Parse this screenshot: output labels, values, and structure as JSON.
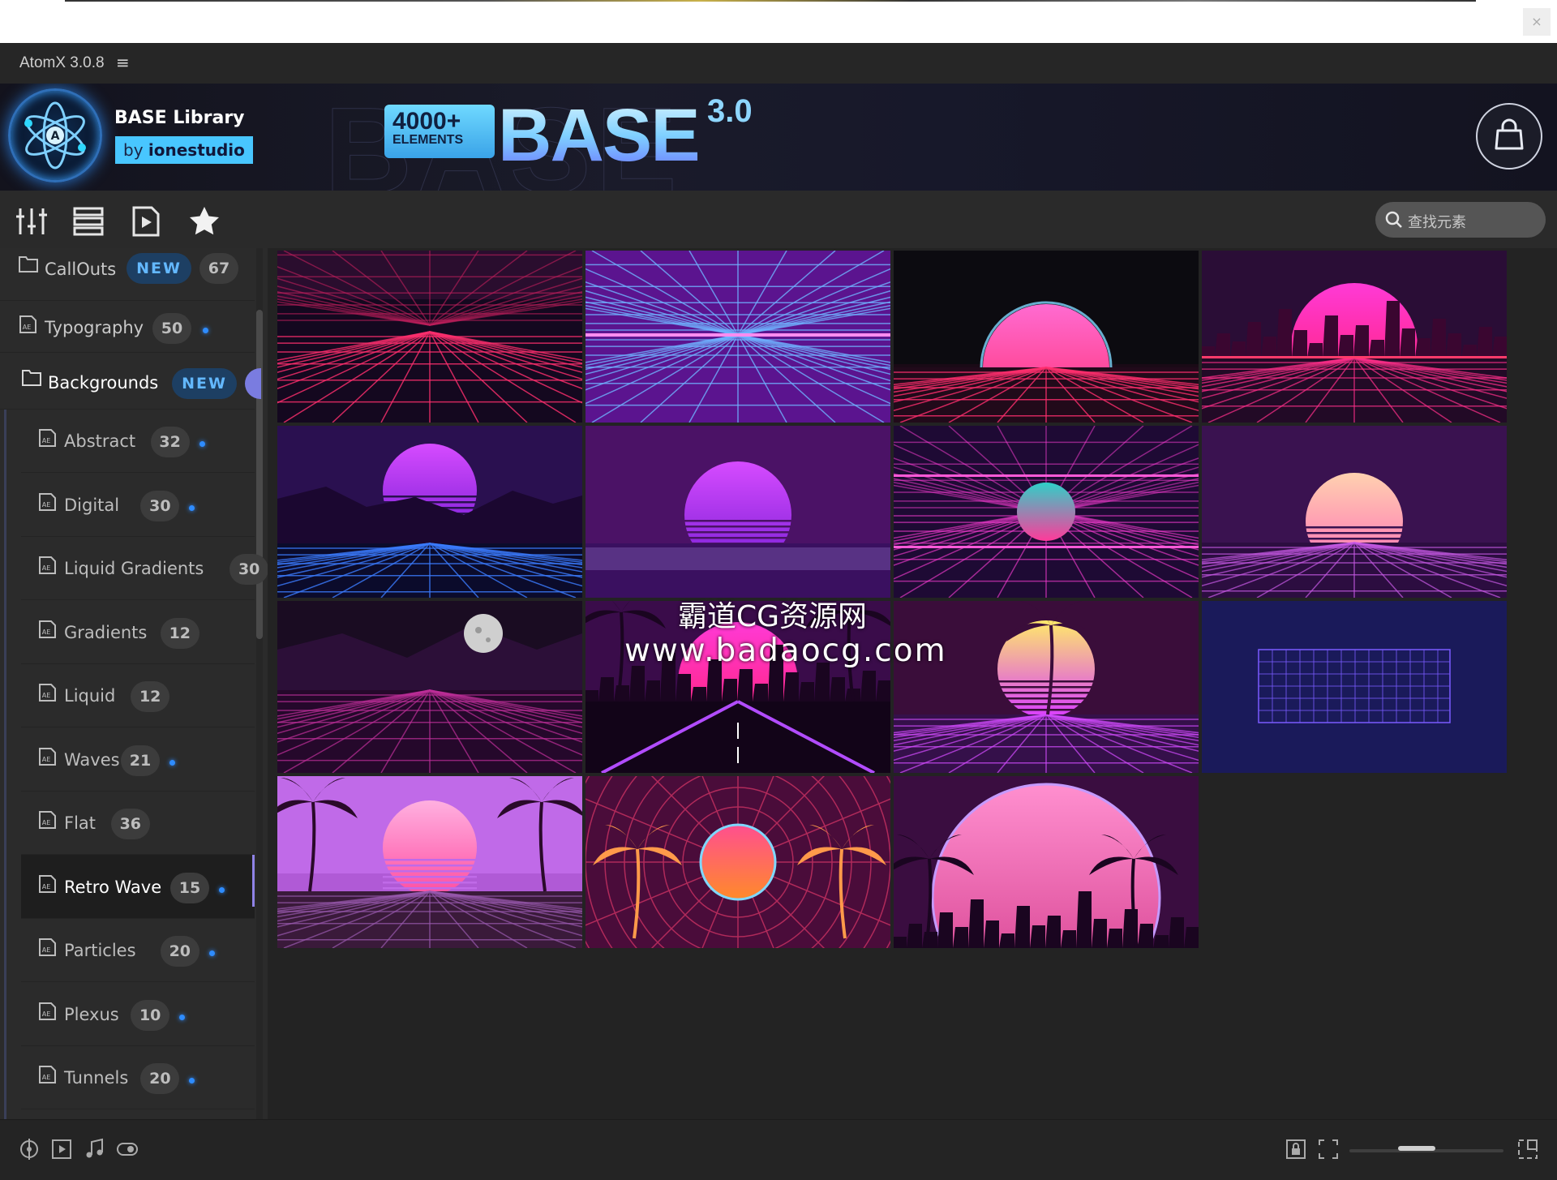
{
  "app": {
    "title": "AtomX 3.0.8",
    "menu_glyph": "≡"
  },
  "banner": {
    "library_name": "BASE Library",
    "by_prefix": "by",
    "by_author": "ionestudio",
    "badge_count": "4000+",
    "badge_label": "ELEMENTS",
    "base_word": "BASE",
    "version": "3.0"
  },
  "search": {
    "placeholder": "查找元素"
  },
  "sidebar": {
    "items": [
      {
        "label": "CallOuts",
        "badge_new": "NEW",
        "count": "67",
        "icon": "folder-icon",
        "dot": false
      },
      {
        "label": "Typography",
        "count": "50",
        "icon": "ae-file-icon",
        "dot": true
      },
      {
        "label": "Backgrounds",
        "badge_new": "NEW",
        "icon": "folder-icon",
        "dot": false
      }
    ],
    "subitems": [
      {
        "label": "Abstract",
        "count": "32",
        "dot": true
      },
      {
        "label": "Digital",
        "count": "30",
        "dot": true
      },
      {
        "label": "Liquid Gradients",
        "count": "30",
        "dot": false
      },
      {
        "label": "Gradients",
        "count": "12",
        "dot": false
      },
      {
        "label": "Liquid",
        "count": "12",
        "dot": false
      },
      {
        "label": "Waves",
        "count": "21",
        "dot": true
      },
      {
        "label": "Flat",
        "count": "36",
        "dot": false
      },
      {
        "label": "Retro Wave",
        "count": "15",
        "dot": true,
        "selected": true
      },
      {
        "label": "Particles",
        "count": "20",
        "dot": true
      },
      {
        "label": "Plexus",
        "count": "10",
        "dot": true
      },
      {
        "label": "Tunnels",
        "count": "20",
        "dot": true
      }
    ]
  },
  "watermark": {
    "line1": "霸道CG资源网",
    "line2": "www.badaocg.com"
  },
  "thumbnails": [
    {
      "name": "retro-grid-red"
    },
    {
      "name": "retro-grid-blue-purple"
    },
    {
      "name": "retro-sun-dark"
    },
    {
      "name": "retro-city-sun-pink"
    },
    {
      "name": "retro-mountain-sun-purple"
    },
    {
      "name": "retro-sun-purple-stars"
    },
    {
      "name": "retro-teal-orb"
    },
    {
      "name": "retro-sun-peach"
    },
    {
      "name": "retro-moon-mountains"
    },
    {
      "name": "retro-city-road"
    },
    {
      "name": "retro-palm-yellow-sun"
    },
    {
      "name": "retro-blue-grid-space"
    },
    {
      "name": "retro-palms-pink-sky"
    },
    {
      "name": "retro-palms-red-orb"
    },
    {
      "name": "retro-big-pink-planet-city"
    }
  ],
  "colors": {
    "accent_blue": "#48c6ff",
    "new_badge_text": "#63b8ff",
    "selection_bar": "#8f82e6",
    "dot_blue": "#2e8cff"
  }
}
